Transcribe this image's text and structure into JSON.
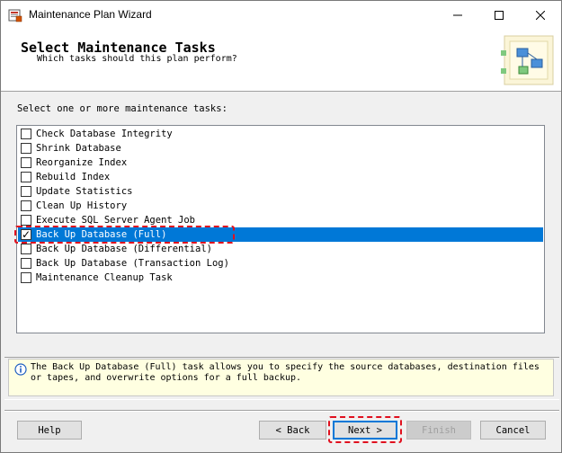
{
  "window": {
    "title": "Maintenance Plan Wizard"
  },
  "header": {
    "title": "Select Maintenance Tasks",
    "subtitle": "Which tasks should this plan perform?"
  },
  "prompt": "Select one or more maintenance tasks:",
  "tasks": [
    {
      "label": "Check Database Integrity",
      "checked": false
    },
    {
      "label": "Shrink Database",
      "checked": false
    },
    {
      "label": "Reorganize Index",
      "checked": false
    },
    {
      "label": "Rebuild Index",
      "checked": false
    },
    {
      "label": "Update Statistics",
      "checked": false
    },
    {
      "label": "Clean Up History",
      "checked": false
    },
    {
      "label": "Execute SQL Server Agent Job",
      "checked": false
    },
    {
      "label": "Back Up Database (Full)",
      "checked": true,
      "selected": true
    },
    {
      "label": "Back Up Database (Differential)",
      "checked": false
    },
    {
      "label": "Back Up Database (Transaction Log)",
      "checked": false
    },
    {
      "label": "Maintenance Cleanup Task",
      "checked": false
    }
  ],
  "description": "The Back Up Database (Full) task allows you to specify the source databases, destination files or tapes, and overwrite options for a full backup.",
  "buttons": {
    "help": "Help",
    "back": "< Back",
    "next": "Next >",
    "finish": "Finish",
    "cancel": "Cancel"
  },
  "colors": {
    "selection": "#0078d7",
    "highlight_dash": "#e0101e",
    "info_background": "#ffffe1"
  }
}
